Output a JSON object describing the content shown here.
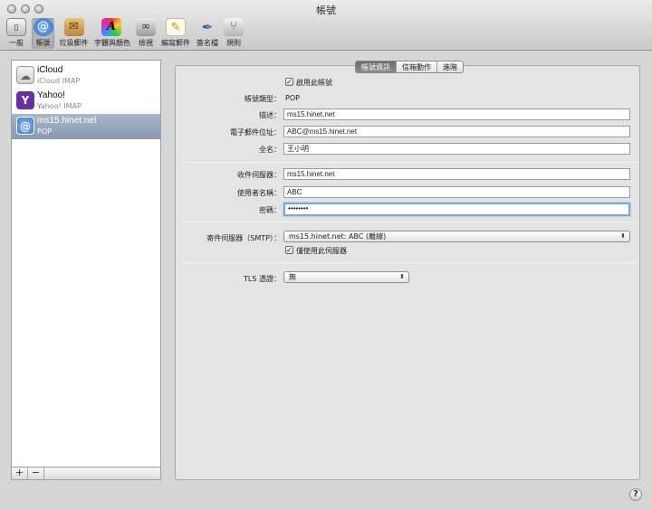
{
  "window": {
    "title": "帳號"
  },
  "toolbar": [
    {
      "label": "一般",
      "icon": "switch-icon"
    },
    {
      "label": "帳號",
      "icon": "at-sign-icon",
      "selected": true
    },
    {
      "label": "垃圾郵件",
      "icon": "junk-mail-icon"
    },
    {
      "label": "字體與顏色",
      "icon": "fonts-colors-icon"
    },
    {
      "label": "檢視",
      "icon": "glasses-icon"
    },
    {
      "label": "編寫郵件",
      "icon": "composing-pen-icon"
    },
    {
      "label": "簽名檔",
      "icon": "signature-icon"
    },
    {
      "label": "規則",
      "icon": "rules-icon"
    }
  ],
  "accounts": [
    {
      "name": "iCloud",
      "type": "iCloud IMAP",
      "icon": "cloud-icon"
    },
    {
      "name": "Yahoo!",
      "type": "Yahoo! IMAP",
      "icon": "yahoo-icon"
    },
    {
      "name": "ms15.hinet.net",
      "type": "POP",
      "icon": "at-sign-icon",
      "selected": true
    }
  ],
  "sidebar_buttons": {
    "add": "+",
    "remove": "−"
  },
  "tabs": [
    {
      "label": "帳號資訊",
      "active": true
    },
    {
      "label": "信箱動作"
    },
    {
      "label": "進階"
    }
  ],
  "form": {
    "enable_account": {
      "label": "啟用此帳號",
      "checked": true
    },
    "account_type": {
      "label": "帳號類型：",
      "value": "POP"
    },
    "description": {
      "label": "描述：",
      "value": "ms15.hinet.net"
    },
    "email": {
      "label": "電子郵件位址：",
      "value": "ABC@ms15.hinet.net"
    },
    "full_name": {
      "label": "全名：",
      "value": "王小明"
    },
    "incoming_server": {
      "label": "收件伺服器：",
      "value": "ms15.hinet.net"
    },
    "username": {
      "label": "使用者名稱：",
      "value": "ABC"
    },
    "password": {
      "label": "密碼：",
      "value": "••••••••"
    },
    "outgoing_server": {
      "label": "寄件伺服器（SMTP）：",
      "value": "ms15.hinet.net: ABC (離線)"
    },
    "only_this_server": {
      "label": "僅使用此伺服器",
      "checked": true
    },
    "tls_cert": {
      "label": "TLS 憑證：",
      "value": "無"
    }
  },
  "help": {
    "label": "?"
  },
  "colors": {
    "selection": "#8d9db5",
    "focus_ring": "#7aa7e0",
    "panel": "#e4e4e4"
  }
}
